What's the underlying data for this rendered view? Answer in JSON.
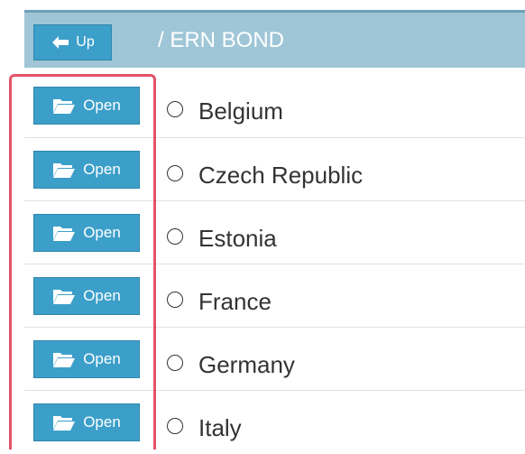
{
  "header": {
    "up_label": "Up",
    "path": "/ ERN BOND"
  },
  "rows": [
    {
      "open_label": "Open",
      "country": "Belgium"
    },
    {
      "open_label": "Open",
      "country": "Czech Republic"
    },
    {
      "open_label": "Open",
      "country": "Estonia"
    },
    {
      "open_label": "Open",
      "country": "France"
    },
    {
      "open_label": "Open",
      "country": "Germany"
    },
    {
      "open_label": "Open",
      "country": "Italy"
    }
  ],
  "colors": {
    "header_bg": "#9fc6d7",
    "button_bg": "#3c9fc9",
    "highlight": "#e0364b"
  },
  "icons": {
    "up": "arrow-left-icon",
    "open": "folder-open-icon",
    "select": "radio-button"
  }
}
